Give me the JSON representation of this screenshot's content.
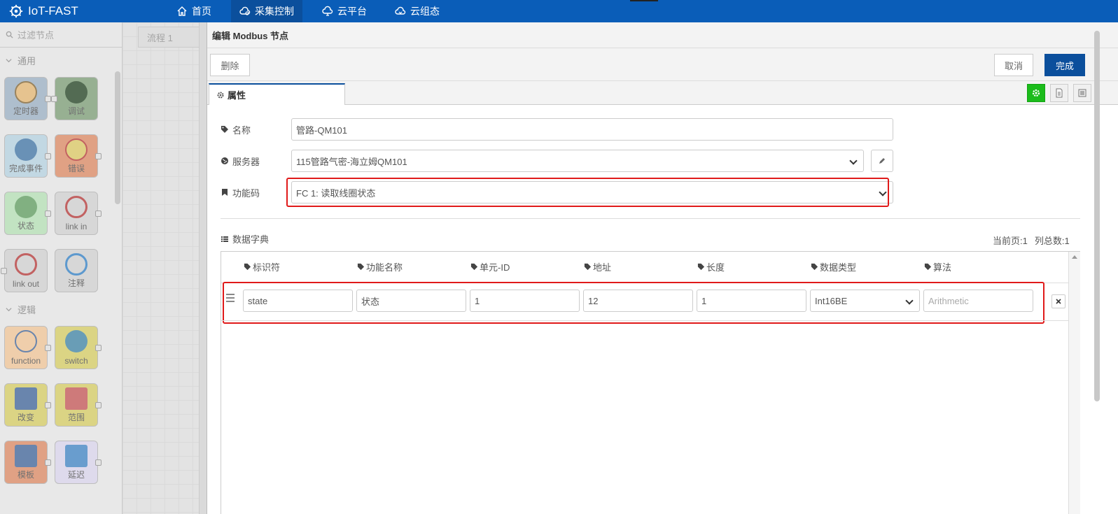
{
  "app": {
    "title": "IoT-FAST",
    "nav": [
      {
        "label": "首页",
        "icon": "home-icon"
      },
      {
        "label": "采集控制",
        "icon": "cloud-gear-icon"
      },
      {
        "label": "云平台",
        "icon": "cloud-platform-icon"
      },
      {
        "label": "云组态",
        "icon": "cloud-config-icon"
      }
    ]
  },
  "palette": {
    "filter_placeholder": "过滤节点",
    "categories": [
      {
        "label": "通用",
        "nodes": [
          {
            "label": "定时器",
            "color": "#a6bbcf"
          },
          {
            "label": "调试",
            "color": "#87a980"
          },
          {
            "label": "完成事件",
            "color": "#c0deed"
          },
          {
            "label": "错误",
            "color": "#e9956e"
          },
          {
            "label": "状态",
            "color": "#c0edc0"
          },
          {
            "label": "link in",
            "color": "#dddddd"
          },
          {
            "label": "link out",
            "color": "#dddddd"
          },
          {
            "label": "注释",
            "color": "#dddddd"
          }
        ]
      },
      {
        "label": "逻辑",
        "nodes": [
          {
            "label": "function",
            "color": "#fdd0a2"
          },
          {
            "label": "switch",
            "color": "#e2d96e"
          },
          {
            "label": "改变",
            "color": "#e2d96e"
          },
          {
            "label": "范围",
            "color": "#e2d96e"
          },
          {
            "label": "模板",
            "color": "#e9956e"
          },
          {
            "label": "延迟",
            "color": "#e6e0f8"
          }
        ]
      }
    ]
  },
  "workspace": {
    "tab": "流程 1"
  },
  "tray": {
    "title": "编辑 Modbus 节点",
    "delete_label": "删除",
    "cancel_label": "取消",
    "done_label": "完成",
    "tab_label": "属性",
    "fields": {
      "name_label": "名称",
      "name_value": "管路-QM101",
      "server_label": "服务器",
      "server_value": "115管路气密-海立姆QM101",
      "fc_label": "功能码",
      "fc_value": "FC 1: 读取线圈状态"
    },
    "dict": {
      "label": "数据字典",
      "current_page": "当前页:1",
      "total_cols": "列总数:1",
      "columns": [
        "标识符",
        "功能名称",
        "单元-ID",
        "地址",
        "长度",
        "数据类型",
        "算法"
      ],
      "rows": [
        {
          "id": "state",
          "name": "状态",
          "unit": "1",
          "address": "12",
          "length": "1",
          "type": "Int16BE",
          "algo_placeholder": "Arithmetic"
        }
      ]
    }
  },
  "colors": {
    "topbar": "#0a5db8",
    "primary": "#0b4f9c",
    "highlight": "#e01a1a",
    "green": "#1bbc1b"
  }
}
